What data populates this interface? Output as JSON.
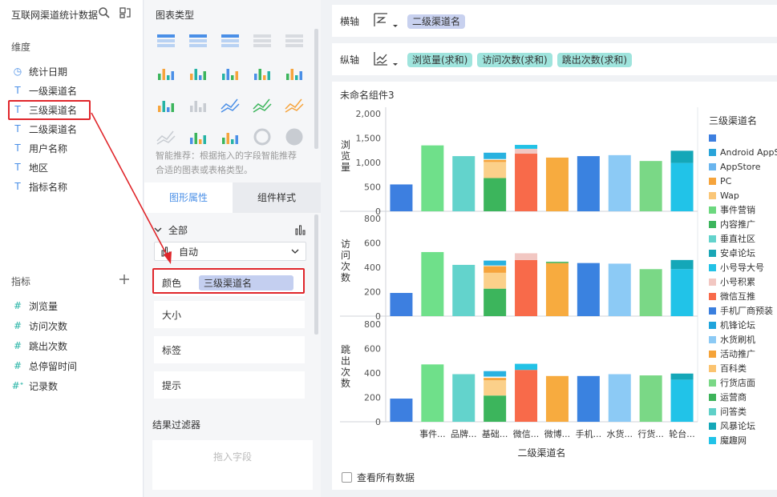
{
  "left": {
    "dataset_name": "互联网渠道统计数据",
    "dimension_title": "维度",
    "dimensions": [
      {
        "icon": "calendar-icon",
        "glyph": "◷",
        "label": "统计日期"
      },
      {
        "icon": "text-type-icon",
        "glyph": "T",
        "label": "一级渠道名"
      },
      {
        "icon": "text-type-icon",
        "glyph": "T",
        "label": "三级渠道名"
      },
      {
        "icon": "text-type-icon",
        "glyph": "T",
        "label": "二级渠道名"
      },
      {
        "icon": "text-type-icon",
        "glyph": "T",
        "label": "用户名称"
      },
      {
        "icon": "text-type-icon",
        "glyph": "T",
        "label": "地区"
      },
      {
        "icon": "text-type-icon",
        "glyph": "T",
        "label": "指标名称"
      }
    ],
    "metric_title": "指标",
    "metrics": [
      {
        "glyph": "#",
        "label": "浏览量"
      },
      {
        "glyph": "#",
        "label": "访问次数"
      },
      {
        "glyph": "#",
        "label": "跳出次数"
      },
      {
        "glyph": "#",
        "label": "总停留时间"
      },
      {
        "glyph": "#ᐩ",
        "label": "记录数"
      }
    ]
  },
  "middle": {
    "chart_type_title": "图表类型",
    "hint": "智能推荐：根据拖入的字段智能推荐合适的图表或表格类型。",
    "tab_graph": "图形属性",
    "tab_style": "组件样式",
    "all_label": "全部",
    "auto_label": "自动",
    "color_label": "颜色",
    "color_field": "三级渠道名",
    "size_label": "大小",
    "tag_label": "标签",
    "tip_label": "提示",
    "filter_title": "结果过滤器",
    "filter_placeholder": "拖入字段"
  },
  "axes": {
    "x_label": "横轴",
    "x_fields": [
      "二级渠道名"
    ],
    "y_label": "纵轴",
    "y_fields": [
      "浏览量(求和)",
      "访问次数(求和)",
      "跳出次数(求和)"
    ]
  },
  "chart": {
    "component_title": "未命名组件3",
    "show_all": "查看所有数据",
    "legend_title": "三级渠道名",
    "legend": [
      {
        "name": "",
        "color": "#3d7fe0"
      },
      {
        "name": "Android AppS",
        "color": "#29a4d9"
      },
      {
        "name": "AppStore",
        "color": "#6ab5ee"
      },
      {
        "name": "PC",
        "color": "#f6a43c"
      },
      {
        "name": "Wap",
        "color": "#fac677"
      },
      {
        "name": "事件营销",
        "color": "#6cd87f"
      },
      {
        "name": "内容推广",
        "color": "#3cb55c"
      },
      {
        "name": "垂直社区",
        "color": "#63d3cc"
      },
      {
        "name": "安卓论坛",
        "color": "#1aa6b6"
      },
      {
        "name": "小号导大号",
        "color": "#22c2e6"
      },
      {
        "name": "小号积累",
        "color": "#f2c7c2"
      },
      {
        "name": "微信互推",
        "color": "#f86a4a"
      },
      {
        "name": "手机厂商预装",
        "color": "#3a7fde"
      },
      {
        "name": "机锋论坛",
        "color": "#1fa4dc"
      },
      {
        "name": "水货刷机",
        "color": "#8ccaf5"
      },
      {
        "name": "活动推广",
        "color": "#f5a338"
      },
      {
        "name": "百科类",
        "color": "#fbc36f"
      },
      {
        "name": "行货店面",
        "color": "#7ad886"
      },
      {
        "name": "运营商",
        "color": "#3db35a"
      },
      {
        "name": "问答类",
        "color": "#5fd0c8"
      },
      {
        "name": "风暴论坛",
        "color": "#14a7b8"
      },
      {
        "name": "魔趣网",
        "color": "#21c3e8"
      }
    ]
  },
  "chart_data": {
    "type": "bar",
    "xlabel": "二级渠道名",
    "categories": [
      "",
      "事件...",
      "品牌...",
      "基础...",
      "微信...",
      "微博...",
      "手机...",
      "水货...",
      "行货...",
      "轮台..."
    ],
    "panels": [
      {
        "ylabel": "浏览量",
        "ylim": [
          0,
          2000
        ],
        "ticks": [
          "0",
          "500",
          "1,000",
          "1,500",
          "2,000"
        ],
        "tick_values": [
          0,
          500,
          1000,
          1500,
          2000
        ],
        "stacks": [
          [
            {
              "v": 550,
              "c": "#3d7fe0"
            }
          ],
          [
            {
              "v": 1350,
              "c": "#6fe08a"
            }
          ],
          [
            {
              "v": 1130,
              "c": "#63d3cc"
            }
          ],
          [
            {
              "v": 680,
              "c": "#3cb55c"
            },
            {
              "v": 330,
              "c": "#fbd08a"
            },
            {
              "v": 45,
              "c": "#f6a43c"
            },
            {
              "v": 15,
              "c": "#ffffff"
            },
            {
              "v": 130,
              "c": "#29b2e0"
            }
          ],
          [
            {
              "v": 1180,
              "c": "#f86a4a"
            },
            {
              "v": 100,
              "c": "#f2c7c2"
            },
            {
              "v": 80,
              "c": "#22c2e6"
            }
          ],
          [
            {
              "v": 1100,
              "c": "#f7ab3f"
            }
          ],
          [
            {
              "v": 1130,
              "c": "#3a82e0"
            }
          ],
          [
            {
              "v": 1150,
              "c": "#8ccaf5"
            }
          ],
          [
            {
              "v": 1030,
              "c": "#7ad886"
            }
          ],
          [
            {
              "v": 990,
              "c": "#21c3e8"
            },
            {
              "v": 250,
              "c": "#14a7b8"
            }
          ]
        ]
      },
      {
        "ylabel": "访问次数",
        "ylim": [
          0,
          800
        ],
        "ticks": [
          "0",
          "200",
          "400",
          "600",
          "800"
        ],
        "tick_values": [
          0,
          200,
          400,
          600,
          800
        ],
        "stacks": [
          [
            {
              "v": 190,
              "c": "#3d7fe0"
            }
          ],
          [
            {
              "v": 525,
              "c": "#6fe08a"
            }
          ],
          [
            {
              "v": 420,
              "c": "#63d3cc"
            }
          ],
          [
            {
              "v": 225,
              "c": "#3cb55c"
            },
            {
              "v": 130,
              "c": "#fbd08a"
            },
            {
              "v": 55,
              "c": "#f6a43c"
            },
            {
              "v": 5,
              "c": "#ffffff"
            },
            {
              "v": 40,
              "c": "#29b2e0"
            }
          ],
          [
            {
              "v": 460,
              "c": "#f86a4a"
            },
            {
              "v": 55,
              "c": "#f2c7c2"
            }
          ],
          [
            {
              "v": 435,
              "c": "#f7ab3f"
            },
            {
              "v": 10,
              "c": "#3cb55c"
            }
          ],
          [
            {
              "v": 435,
              "c": "#3a82e0"
            }
          ],
          [
            {
              "v": 430,
              "c": "#8ccaf5"
            }
          ],
          [
            {
              "v": 385,
              "c": "#7ad886"
            }
          ],
          [
            {
              "v": 385,
              "c": "#21c3e8"
            },
            {
              "v": 75,
              "c": "#14a7b8"
            }
          ]
        ]
      },
      {
        "ylabel": "跳出次数",
        "ylim": [
          0,
          800
        ],
        "ticks": [
          "0",
          "200",
          "400",
          "600",
          "800"
        ],
        "tick_values": [
          0,
          200,
          400,
          600,
          800
        ],
        "stacks": [
          [
            {
              "v": 190,
              "c": "#3d7fe0"
            }
          ],
          [
            {
              "v": 470,
              "c": "#6fe08a"
            }
          ],
          [
            {
              "v": 390,
              "c": "#63d3cc"
            }
          ],
          [
            {
              "v": 215,
              "c": "#3cb55c"
            },
            {
              "v": 125,
              "c": "#fbd08a"
            },
            {
              "v": 20,
              "c": "#f6a43c"
            },
            {
              "v": 10,
              "c": "#ffffff"
            },
            {
              "v": 45,
              "c": "#29b2e0"
            }
          ],
          [
            {
              "v": 425,
              "c": "#f86a4a"
            },
            {
              "v": 50,
              "c": "#22c2e6"
            }
          ],
          [
            {
              "v": 375,
              "c": "#f7ab3f"
            }
          ],
          [
            {
              "v": 375,
              "c": "#3a82e0"
            }
          ],
          [
            {
              "v": 390,
              "c": "#8ccaf5"
            }
          ],
          [
            {
              "v": 380,
              "c": "#7ad886"
            }
          ],
          [
            {
              "v": 345,
              "c": "#21c3e8"
            },
            {
              "v": 50,
              "c": "#14a7b8"
            }
          ]
        ]
      }
    ]
  }
}
